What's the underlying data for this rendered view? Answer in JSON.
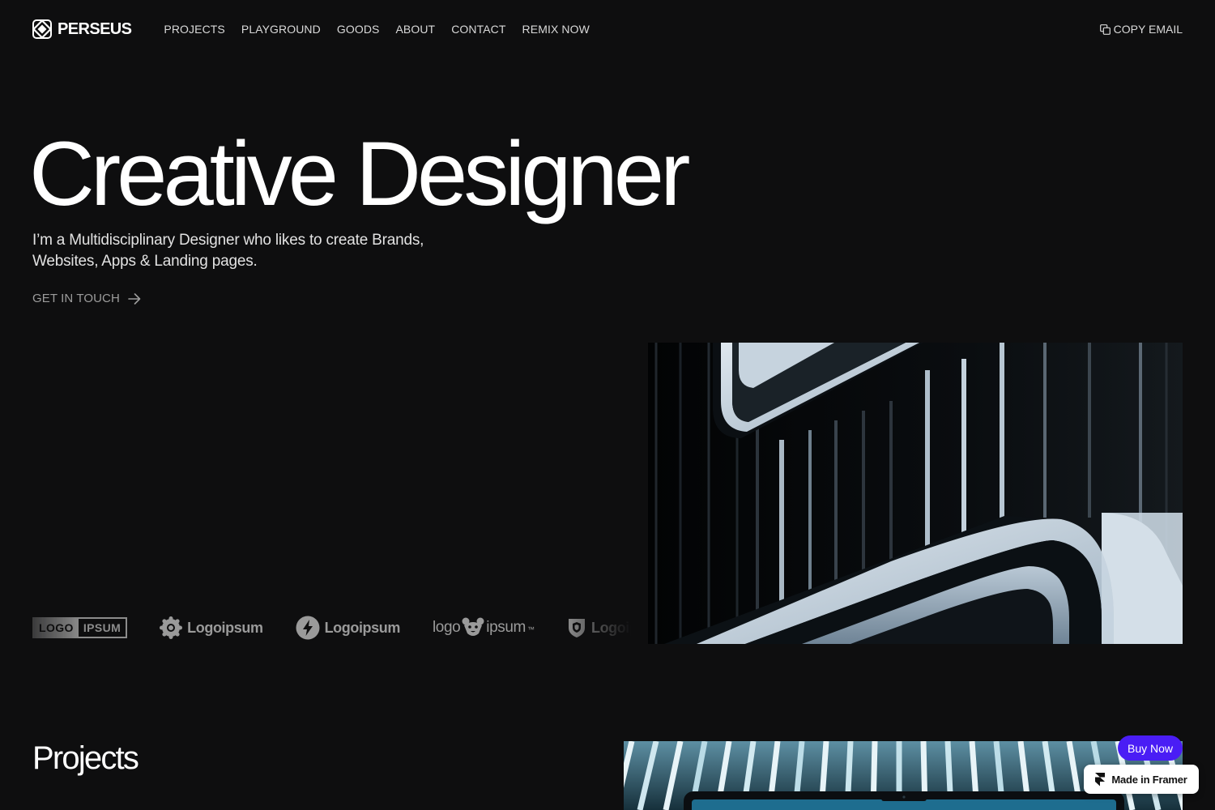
{
  "brand": {
    "name": "PERSEUS",
    "icon": "perseus-logo-icon"
  },
  "nav": {
    "items": [
      {
        "label": "PROJECTS"
      },
      {
        "label": "PLAYGROUND"
      },
      {
        "label": "GOODS"
      },
      {
        "label": "ABOUT"
      },
      {
        "label": "CONTACT"
      },
      {
        "label": "REMIX NOW"
      }
    ],
    "copy_email": {
      "label": "COPY EMAIL",
      "icon": "copy-icon"
    }
  },
  "hero": {
    "title": "Creative Designer",
    "description": "I’m a Multidisciplinary Designer who likes to create Brands, Websites, Apps & Landing pages.",
    "cta": {
      "label": "GET IN TOUCH",
      "icon": "arrow-right-icon"
    },
    "image": "architecture-balconies-image"
  },
  "logos": {
    "items": [
      {
        "text_a": "LOGO",
        "text_b": "IPSUM",
        "icon": "logo-box-icon"
      },
      {
        "text": "Logoipsum",
        "icon": "sunburst-icon"
      },
      {
        "text": "Logoipsum",
        "icon": "bolt-circle-icon"
      },
      {
        "text_a": "logo",
        "text_b": "ipsum",
        "tm": "™",
        "icon": "bear-icon"
      },
      {
        "text": "Logoipsum",
        "icon": "shield-icon"
      }
    ]
  },
  "projects": {
    "title": "Projects",
    "image": "project-laptop-image"
  },
  "badges": {
    "buy_now": "Buy Now",
    "framer": "Made in Framer",
    "framer_icon": "framer-icon"
  },
  "colors": {
    "background": "#0e0e0f",
    "text": "#ffffff",
    "muted": "#9c9c9c",
    "accent": "#4a1df5"
  }
}
